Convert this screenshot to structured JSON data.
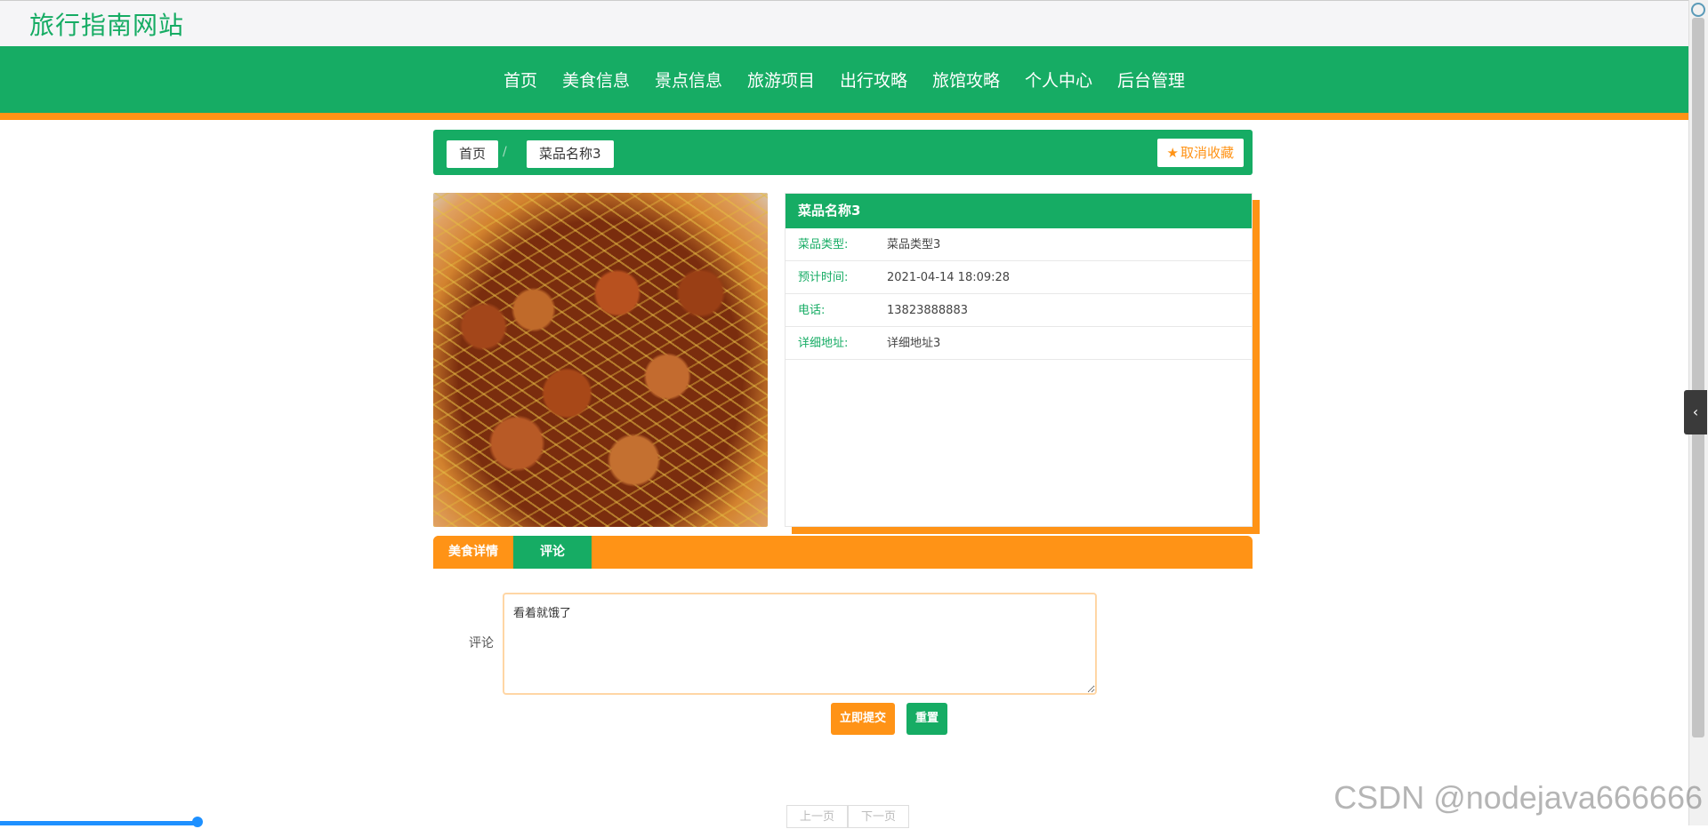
{
  "site": {
    "title": "旅行指南网站"
  },
  "nav": {
    "items": [
      "首页",
      "美食信息",
      "景点信息",
      "旅游项目",
      "出行攻略",
      "旅馆攻略",
      "个人中心",
      "后台管理"
    ]
  },
  "breadcrumb": {
    "home": "首页",
    "separator": "/",
    "current": "菜品名称3"
  },
  "favorite": {
    "icon": "star-icon",
    "label": "取消收藏"
  },
  "detail": {
    "title": "菜品名称3",
    "rows": [
      {
        "label": "菜品类型:",
        "value": "菜品类型3"
      },
      {
        "label": "预计时间:",
        "value": "2021-04-14 18:09:28"
      },
      {
        "label": "电话:",
        "value": "13823888883"
      },
      {
        "label": "详细地址:",
        "value": "详细地址3"
      }
    ]
  },
  "tabs": {
    "food_detail": "美食详情",
    "comment": "评论"
  },
  "comment_form": {
    "label": "评论",
    "value": "看着就饿了",
    "submit_label": "立即提交",
    "reset_label": "重置"
  },
  "pager": {
    "prev": "上一页",
    "next": "下一页"
  },
  "watermark": "CSDN @nodejava666666",
  "colors": {
    "primary": "#16ac64",
    "accent": "#ff9316"
  }
}
